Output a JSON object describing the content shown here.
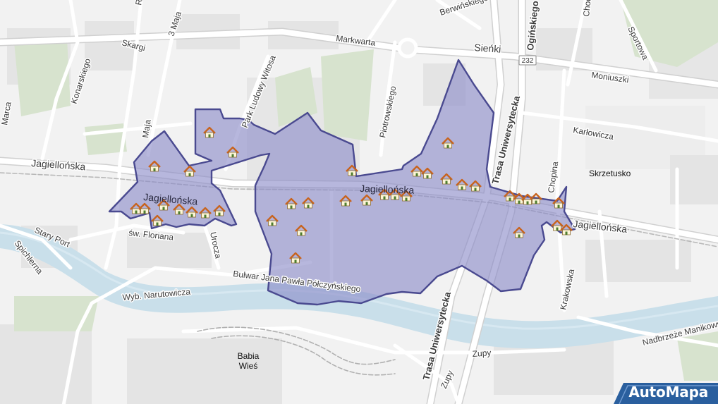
{
  "map": {
    "labels": {
      "berwinskiego": "Berwińskiego",
      "oginskiego": "Ogińskiego",
      "chodkiewicza": "Chodkiewicza",
      "sportowa": "Sportowa",
      "trzeciego_maja": "3 Maja",
      "r_top": "R",
      "skargi": "Skargi",
      "markwarta": "Markwarta",
      "sienki": "Sieńki",
      "road_232": "232",
      "moniuszki": "Moniuszki",
      "konarskiego": "Konarskiego",
      "marca": "Marca",
      "park_ludowy": "Park Ludowy Witosa",
      "piotrowskiego": "Piotrowskiego",
      "karlowicza": "Karłowicza",
      "maja_left": "Maja",
      "trasa_uniwersytecka_n": "Trasa Uniwersytecka",
      "jagiellonska_w": "Jagiellońska",
      "skrzetusko": "Skrzetusko",
      "chopina": "Chopina",
      "jagiellonska_area": "Jagiellońska",
      "jagiellonska_mid": "Jagiellońska",
      "jagiellonska_e": "Jagiellońska",
      "stary_port": "Stary Port",
      "sw_floriana": "św. Floriana",
      "spichlerna": "Spichlerna",
      "urocza": "Urocza",
      "bulwar": "Bulwar Jana Pawła Półczyńskiego",
      "wyb_narutowicza": "Wyb. Narutowicza",
      "krakowska": "Krakowska",
      "nadbrzeze": "Nadbrzeże Manikowskiego",
      "zupy_h": "Zupy",
      "zupy_v": "Zupy",
      "trasa_uniwersytecka_s": "Trasa Uniwersytecka",
      "babia_wies_1": "Babia",
      "babia_wies_2": "Wieś"
    },
    "house_icon_count": 40,
    "colors": {
      "highlight_fill": "#8a8ac8",
      "highlight_border": "#4a4a90",
      "water": "#c9dfea",
      "park": "#d7e3ce",
      "road": "#ffffff",
      "building": "#dcdcdc",
      "house_roof": "#c8641e",
      "brand_bg": "#2a5f9e"
    }
  },
  "brand": {
    "name": "AutoMapa"
  }
}
